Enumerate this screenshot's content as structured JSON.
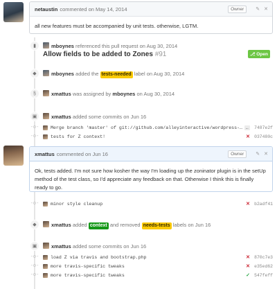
{
  "comments": [
    {
      "author": "netaustin",
      "meta": "commented on May 14, 2014",
      "owner_label": "Owner",
      "body": "all new features must be accompanied by unit tests. otherwise, LGTM."
    },
    {
      "author": "xmattus",
      "meta": "commented on Jun 16",
      "owner_label": "Owner",
      "body": "Ok, tests added. I'm not sure how kosher the way I'm loading up the zoninator plugin is in the setUp method of the test class, so I'd appreciate any feedback on that. Otherwise I think this is finally ready to go."
    }
  ],
  "reference_event": {
    "user": "mboynes",
    "text": "referenced this pull request on Aug 30, 2014",
    "title": "Allow fields to be added to Zones",
    "number": "#91",
    "state": "Open"
  },
  "label_event_1": {
    "user": "mboynes",
    "pre": "added the",
    "label": "tests-needed",
    "post": "label on Aug 30, 2014"
  },
  "assign_event": {
    "user": "xmattus",
    "text": "was assigned by",
    "assigner": "mboynes",
    "date": "on Aug 30, 2014"
  },
  "commits_event_1": {
    "user": "xmattus",
    "text": "added some commits on Jun 16",
    "commits": [
      {
        "message": "Merge branch 'master' of git://github.com/alleyinteractive/wordpress-…",
        "sha": "7487e2f",
        "status": "none",
        "has_ellipsis": true
      },
      {
        "message": "tests for Z context!",
        "sha": "037480c",
        "status": "fail"
      }
    ]
  },
  "commit_after_comment": {
    "message": "minor style cleanup",
    "sha": "b2adf41",
    "status": "fail"
  },
  "label_event_2": {
    "user": "xmattus",
    "pre": "added",
    "label_added": "context",
    "mid": "and removed",
    "label_removed": "needs-tests",
    "post": "labels on Jun 16"
  },
  "commits_event_2": {
    "user": "xmattus",
    "text": "added some commits on Jun 16",
    "commits": [
      {
        "message": "load Z via travis and bootstrap.php",
        "sha": "870c7e3",
        "status": "fail"
      },
      {
        "message": "more travis-specific tweaks",
        "sha": "e35ed62",
        "status": "fail"
      },
      {
        "message": "more travis-specific tweaks",
        "sha": "547feff",
        "status": "ok"
      }
    ]
  },
  "icons": {
    "edit": "pencil-icon",
    "delete": "close-icon",
    "bookmark": "bookmark-icon",
    "tag": "tag-icon",
    "person": "person-icon",
    "commit": "git-commit-icon",
    "fail": "✕",
    "ok": "✓"
  },
  "colors": {
    "label_yellow": "#fbca04",
    "label_green": "#159818",
    "open_badge": "#6cc644",
    "status_fail": "#cb2431",
    "status_ok": "#28a745"
  }
}
